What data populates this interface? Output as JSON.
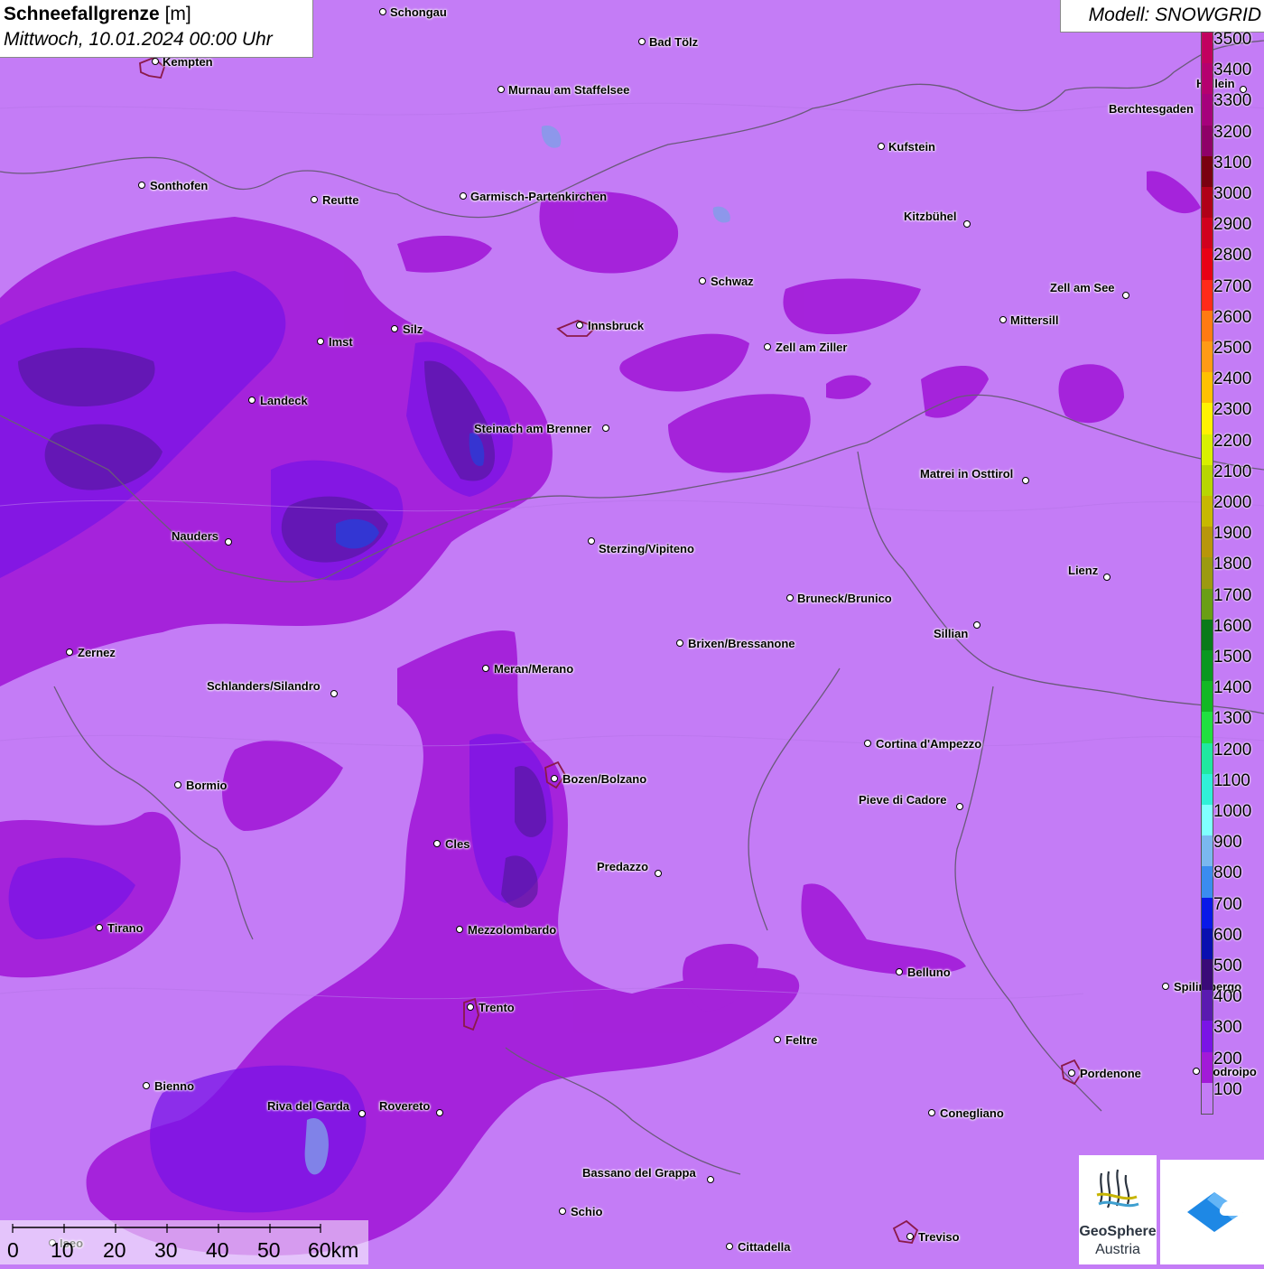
{
  "header": {
    "title": "Schneefallgrenze",
    "unit": "[m]",
    "datetime": "Mittwoch, 10.01.2024 00:00 Uhr",
    "model": "Modell: SNOWGRID"
  },
  "legend": {
    "levels": [
      {
        "label": "3500",
        "color": "#c2005f"
      },
      {
        "label": "3400",
        "color": "#b5006f"
      },
      {
        "label": "3300",
        "color": "#a6007c"
      },
      {
        "label": "3200",
        "color": "#8f0068"
      },
      {
        "label": "3100",
        "color": "#7a0010"
      },
      {
        "label": "3000",
        "color": "#b00018"
      },
      {
        "label": "2900",
        "color": "#d0001e"
      },
      {
        "label": "2800",
        "color": "#e80015"
      },
      {
        "label": "2700",
        "color": "#ff2a1a"
      },
      {
        "label": "2600",
        "color": "#ff7a12"
      },
      {
        "label": "2500",
        "color": "#ff9a15"
      },
      {
        "label": "2400",
        "color": "#ffc000"
      },
      {
        "label": "2300",
        "color": "#fff200"
      },
      {
        "label": "2200",
        "color": "#d8f000"
      },
      {
        "label": "2100",
        "color": "#b8d600"
      },
      {
        "label": "2000",
        "color": "#c7b800"
      },
      {
        "label": "1900",
        "color": "#b8960a"
      },
      {
        "label": "1800",
        "color": "#9c9a10"
      },
      {
        "label": "1700",
        "color": "#6a9e15"
      },
      {
        "label": "1600",
        "color": "#0a7a1a"
      },
      {
        "label": "1500",
        "color": "#0a9820"
      },
      {
        "label": "1400",
        "color": "#12b825"
      },
      {
        "label": "1300",
        "color": "#20e040"
      },
      {
        "label": "1200",
        "color": "#20e8a0"
      },
      {
        "label": "1100",
        "color": "#30f0d8"
      },
      {
        "label": "1000",
        "color": "#80ffff"
      },
      {
        "label": "900",
        "color": "#7ab8f0"
      },
      {
        "label": "800",
        "color": "#3a8cf0"
      },
      {
        "label": "700",
        "color": "#0a18e8"
      },
      {
        "label": "600",
        "color": "#0a0fb0"
      },
      {
        "label": "500",
        "color": "#3a0a78"
      },
      {
        "label": "400",
        "color": "#5a1ab0"
      },
      {
        "label": "300",
        "color": "#7a14e6"
      },
      {
        "label": "200",
        "color": "#a21ad8"
      },
      {
        "label": "100",
        "color": "#c47cf6"
      }
    ]
  },
  "scale": {
    "labels": [
      "0",
      "10",
      "20",
      "30",
      "40",
      "50",
      "60km"
    ]
  },
  "logo": {
    "name_line1": "GeoSphere",
    "name_line2": "Austria"
  },
  "places": [
    {
      "name": "Schongau"
    },
    {
      "name": "Bad Tölz"
    },
    {
      "name": "Kempten"
    },
    {
      "name": "Murnau am Staffelsee"
    },
    {
      "name": "Hallein"
    },
    {
      "name": "Berchtesgaden"
    },
    {
      "name": "Kufstein"
    },
    {
      "name": "Sonthofen"
    },
    {
      "name": "Reutte"
    },
    {
      "name": "Garmisch-Partenkirchen"
    },
    {
      "name": "Kitzbühel"
    },
    {
      "name": "Schwaz"
    },
    {
      "name": "Zell am See"
    },
    {
      "name": "Innsbruck"
    },
    {
      "name": "Mittersill"
    },
    {
      "name": "Silz"
    },
    {
      "name": "Imst"
    },
    {
      "name": "Zell am Ziller"
    },
    {
      "name": "Landeck"
    },
    {
      "name": "Steinach am Brenner"
    },
    {
      "name": "Matrei in Osttirol"
    },
    {
      "name": "Nauders"
    },
    {
      "name": "Sterzing/Vipiteno"
    },
    {
      "name": "Lienz"
    },
    {
      "name": "Bruneck/Brunico"
    },
    {
      "name": "Sillian"
    },
    {
      "name": "Brixen/Bressanone"
    },
    {
      "name": "Zernez"
    },
    {
      "name": "Meran/Merano"
    },
    {
      "name": "Schlanders/Silandro"
    },
    {
      "name": "Cortina d'Ampezzo"
    },
    {
      "name": "Bozen/Bolzano"
    },
    {
      "name": "Bormio"
    },
    {
      "name": "Pieve di Cadore"
    },
    {
      "name": "Cles"
    },
    {
      "name": "Predazzo"
    },
    {
      "name": "Tirano"
    },
    {
      "name": "Mezzolombardo"
    },
    {
      "name": "Belluno"
    },
    {
      "name": "Spilimbergo"
    },
    {
      "name": "Trento"
    },
    {
      "name": "Feltre"
    },
    {
      "name": "Pordenone"
    },
    {
      "name": "Codroipo"
    },
    {
      "name": "Bienno"
    },
    {
      "name": "Riva del Garda"
    },
    {
      "name": "Rovereto"
    },
    {
      "name": "Conegliano"
    },
    {
      "name": "Bassano del Grappa"
    },
    {
      "name": "Schio"
    },
    {
      "name": "Treviso"
    },
    {
      "name": "Cittadella"
    },
    {
      "name": "Iseo"
    }
  ]
}
